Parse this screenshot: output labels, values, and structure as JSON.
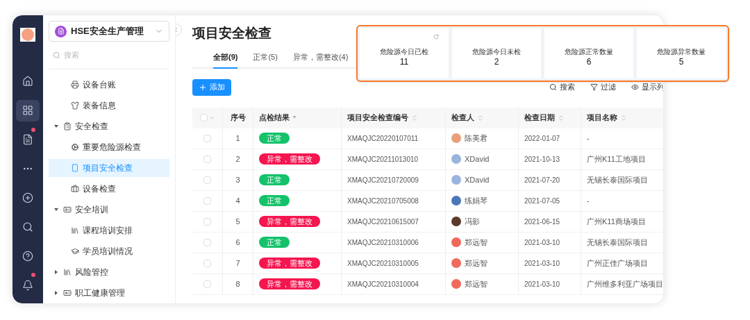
{
  "rail": {
    "items": [
      {
        "kind": "home",
        "selected": false,
        "dot": false
      },
      {
        "kind": "apps",
        "selected": true,
        "dot": false
      },
      {
        "kind": "doc",
        "selected": false,
        "dot": true
      },
      {
        "kind": "more",
        "selected": false,
        "dot": false
      },
      {
        "kind": "add",
        "selected": false,
        "dot": false
      },
      {
        "kind": "search",
        "selected": false,
        "dot": false
      },
      {
        "kind": "help",
        "selected": false,
        "dot": false
      },
      {
        "kind": "bell",
        "selected": false,
        "dot": true
      }
    ]
  },
  "app_switcher": {
    "label": "HSE安全生产管理"
  },
  "nav_search": {
    "placeholder": "搜索"
  },
  "nav": [
    {
      "children": [
        {
          "label": "设备台账",
          "selected": false
        },
        {
          "label": "装备信息",
          "selected": false
        }
      ]
    },
    {
      "label": "安全检查",
      "expanded": true,
      "children": [
        {
          "label": "重要危险源检查",
          "selected": false
        },
        {
          "label": "项目安全检查",
          "selected": true
        },
        {
          "label": "设备检查",
          "selected": false
        }
      ]
    },
    {
      "label": "安全培训",
      "expanded": true,
      "children": [
        {
          "label": "课程培训安排",
          "selected": false
        },
        {
          "label": "学员培训情况",
          "selected": false
        }
      ]
    },
    {
      "label": "风险管控",
      "expanded": false
    },
    {
      "label": "职工健康管理",
      "expanded": false
    }
  ],
  "page_title": "项目安全检查",
  "tabs": [
    {
      "label": "全部(9)",
      "selected": true
    },
    {
      "label": "正常(5)",
      "selected": false
    },
    {
      "label": "异常，需整改(4)",
      "selected": false
    }
  ],
  "add_button": "添加",
  "toolbar": [
    {
      "kind": "search",
      "label": "搜索"
    },
    {
      "kind": "filter",
      "label": "过滤"
    },
    {
      "kind": "columns",
      "label": "显示列"
    }
  ],
  "table": {
    "select_all_checked": false,
    "columns": [
      {
        "label": "序号"
      },
      {
        "label": "点检结果"
      },
      {
        "label": "项目安全检查编号"
      },
      {
        "label": "检查人"
      },
      {
        "label": "检查日期"
      },
      {
        "label": "项目名称"
      }
    ],
    "rows": [
      {
        "checked": false,
        "no": "1",
        "result": {
          "text": "正常",
          "kind": "normal"
        },
        "code": "XMAQJC20220107011",
        "inspector": "陈美君",
        "date": "2022-01-07",
        "project": "-"
      },
      {
        "checked": false,
        "no": "2",
        "result": {
          "text": "异常，需整改",
          "kind": "abnormal"
        },
        "code": "XMAQJC20211013010",
        "inspector": "XDavid",
        "date": "2021-10-13",
        "project": "广州K11工地项目"
      },
      {
        "checked": false,
        "no": "3",
        "result": {
          "text": "正常",
          "kind": "normal"
        },
        "code": "XMAQJC20210720009",
        "inspector": "XDavid",
        "date": "2021-07-20",
        "project": "无锡长泰国际项目"
      },
      {
        "checked": false,
        "no": "4",
        "result": {
          "text": "正常",
          "kind": "normal"
        },
        "code": "XMAQJC20210705008",
        "inspector": "练娟琴",
        "date": "2021-07-05",
        "project": "-"
      },
      {
        "checked": false,
        "no": "5",
        "result": {
          "text": "异常，需整改",
          "kind": "abnormal"
        },
        "code": "XMAQJC20210615007",
        "inspector": "冯影",
        "date": "2021-06-15",
        "project": "广州K11商场项目"
      },
      {
        "checked": false,
        "no": "6",
        "result": {
          "text": "正常",
          "kind": "normal"
        },
        "code": "XMAQJC20210310006",
        "inspector": "郑远智",
        "date": "2021-03-10",
        "project": "无锡长泰国际项目"
      },
      {
        "checked": false,
        "no": "7",
        "result": {
          "text": "异常，需整改",
          "kind": "abnormal"
        },
        "code": "XMAQJC20210310005",
        "inspector": "郑远智",
        "date": "2021-03-10",
        "project": "广州正佳广场项目"
      },
      {
        "checked": false,
        "no": "8",
        "result": {
          "text": "异常，需整改",
          "kind": "abnormal"
        },
        "code": "XMAQJC20210310004",
        "inspector": "郑远智",
        "date": "2021-03-10",
        "project": "广州维多利亚广场项目"
      }
    ]
  },
  "stats": [
    {
      "label": "危险源今日已检",
      "value": "11",
      "refresh": true
    },
    {
      "label": "危险源今日未检",
      "value": "2",
      "refresh": false
    },
    {
      "label": "危险源正常数量",
      "value": "6",
      "refresh": false
    },
    {
      "label": "危险源异常数量",
      "value": "5",
      "refresh": false
    }
  ]
}
